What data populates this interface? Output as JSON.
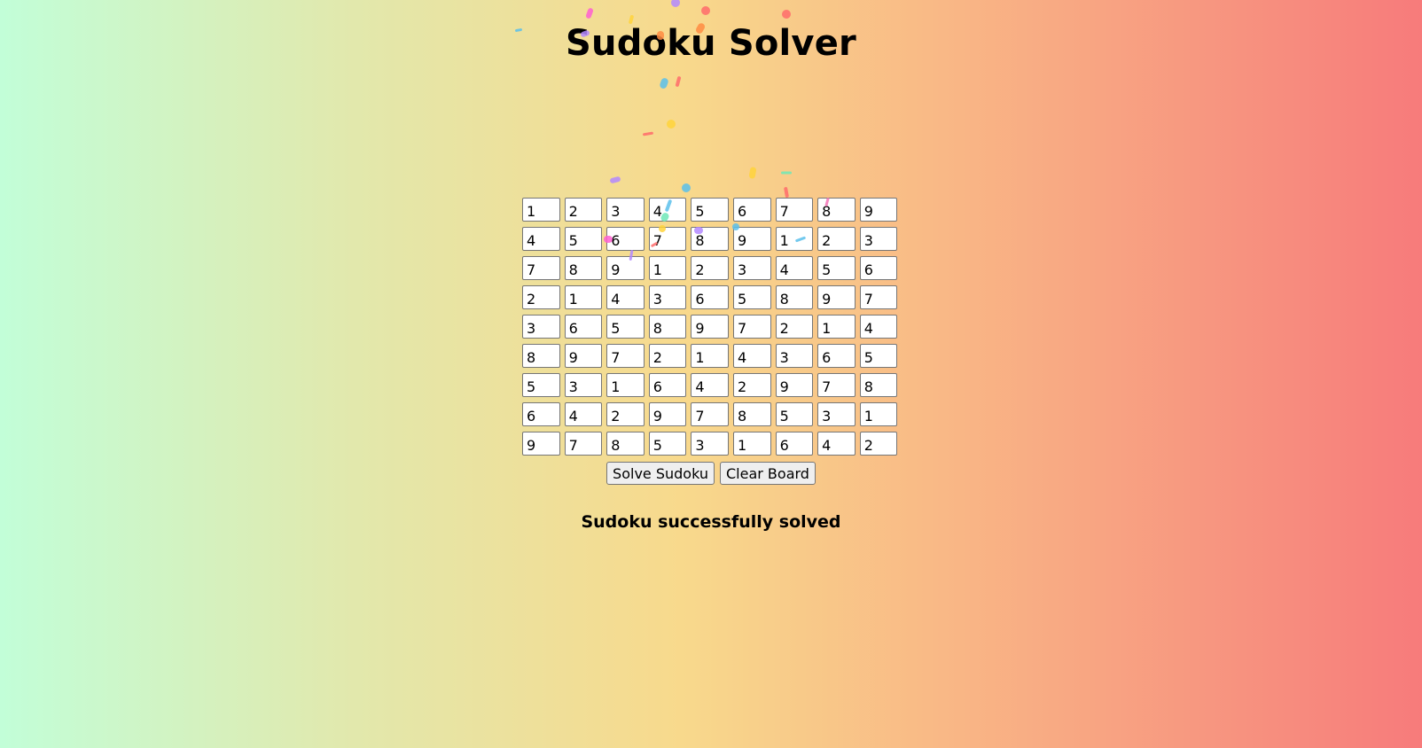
{
  "page": {
    "title": "Sudoku Solver",
    "status": "Sudoku successfully solved"
  },
  "board": [
    [
      "1",
      "2",
      "3",
      "4",
      "5",
      "6",
      "7",
      "8",
      "9"
    ],
    [
      "4",
      "5",
      "6",
      "7",
      "8",
      "9",
      "1",
      "2",
      "3"
    ],
    [
      "7",
      "8",
      "9",
      "1",
      "2",
      "3",
      "4",
      "5",
      "6"
    ],
    [
      "2",
      "1",
      "4",
      "3",
      "6",
      "5",
      "8",
      "9",
      "7"
    ],
    [
      "3",
      "6",
      "5",
      "8",
      "9",
      "7",
      "2",
      "1",
      "4"
    ],
    [
      "8",
      "9",
      "7",
      "2",
      "1",
      "4",
      "3",
      "6",
      "5"
    ],
    [
      "5",
      "3",
      "1",
      "6",
      "4",
      "2",
      "9",
      "7",
      "8"
    ],
    [
      "6",
      "4",
      "2",
      "9",
      "7",
      "8",
      "5",
      "3",
      "1"
    ],
    [
      "9",
      "7",
      "8",
      "5",
      "3",
      "1",
      "6",
      "4",
      "2"
    ]
  ],
  "controls": {
    "solve_label": "Solve Sudoku",
    "clear_label": "Clear Board"
  },
  "colors": {
    "gradient_start": "#c2fed8",
    "gradient_mid": "#f8d98c",
    "gradient_end": "#f77b7b",
    "confetti": [
      "#ff5fd2",
      "#ffd43b",
      "#5bc0eb",
      "#ff8c42",
      "#b388ff",
      "#ff6b6b",
      "#6ee7b7",
      "#f472b6"
    ]
  }
}
